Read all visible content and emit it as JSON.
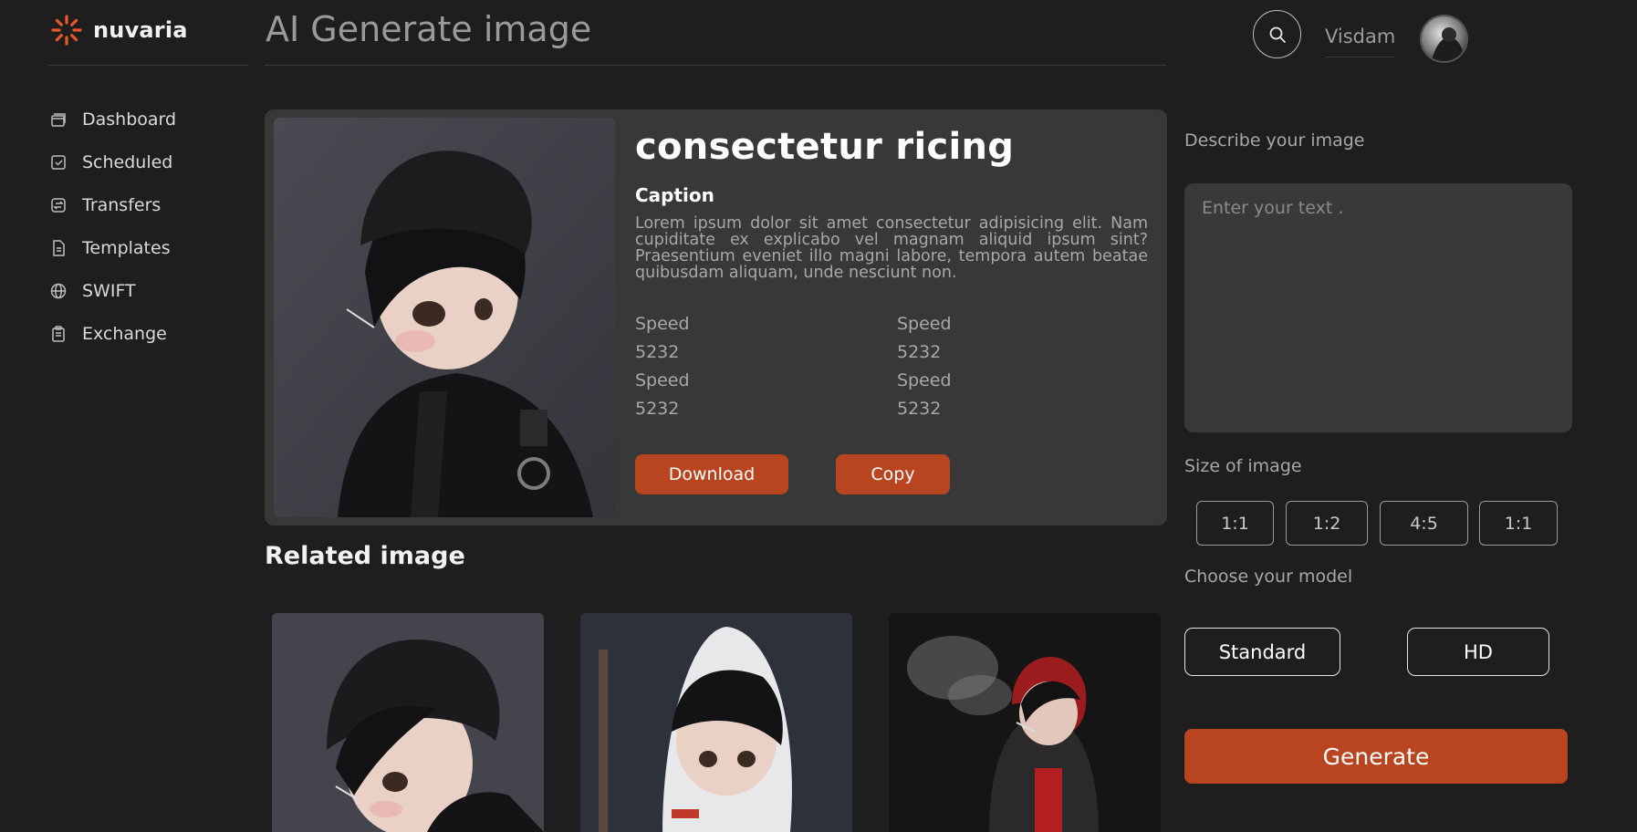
{
  "brand": {
    "name": "nuvaria",
    "accent": "#e8572a"
  },
  "header": {
    "title": "AI Generate image",
    "user_name": "Visdam"
  },
  "sidebar": {
    "items": [
      {
        "label": "Dashboard",
        "icon": "dashboard-icon"
      },
      {
        "label": "Scheduled",
        "icon": "checkbox-icon"
      },
      {
        "label": "Transfers",
        "icon": "transfer-icon"
      },
      {
        "label": "Templates",
        "icon": "document-icon"
      },
      {
        "label": "SWIFT",
        "icon": "globe-icon"
      },
      {
        "label": "Exchange",
        "icon": "clipboard-icon"
      }
    ]
  },
  "result": {
    "title": "consectetur ricing",
    "caption_label": "Caption",
    "caption_text": "Lorem ipsum dolor sit amet consectetur adipisicing elit. Nam cupiditate ex explicabo vel magnam aliquid ipsum sint? Praesentium eveniet illo magni labore, tempora autem beatae quibusdam aliquam, unde nesciunt non.",
    "stats": [
      {
        "label": "Speed",
        "value": "5232"
      },
      {
        "label": "Speed",
        "value": "5232"
      },
      {
        "label": "Speed",
        "value": "5232"
      },
      {
        "label": "Speed",
        "value": "5232"
      }
    ],
    "download_label": "Download",
    "copy_label": "Copy"
  },
  "related": {
    "title": "Related image"
  },
  "panel": {
    "describe_label": "Describe your image",
    "prompt_placeholder": "Enter your text .",
    "size_label": "Size of image",
    "sizes": [
      "1:1",
      "1:2",
      "4:5",
      "1:1"
    ],
    "model_label": "Choose your model",
    "models": [
      "Standard",
      "HD"
    ],
    "generate_label": "Generate"
  },
  "colors": {
    "background": "#1e1e1e",
    "card": "#393838",
    "button": "#b8451f"
  }
}
